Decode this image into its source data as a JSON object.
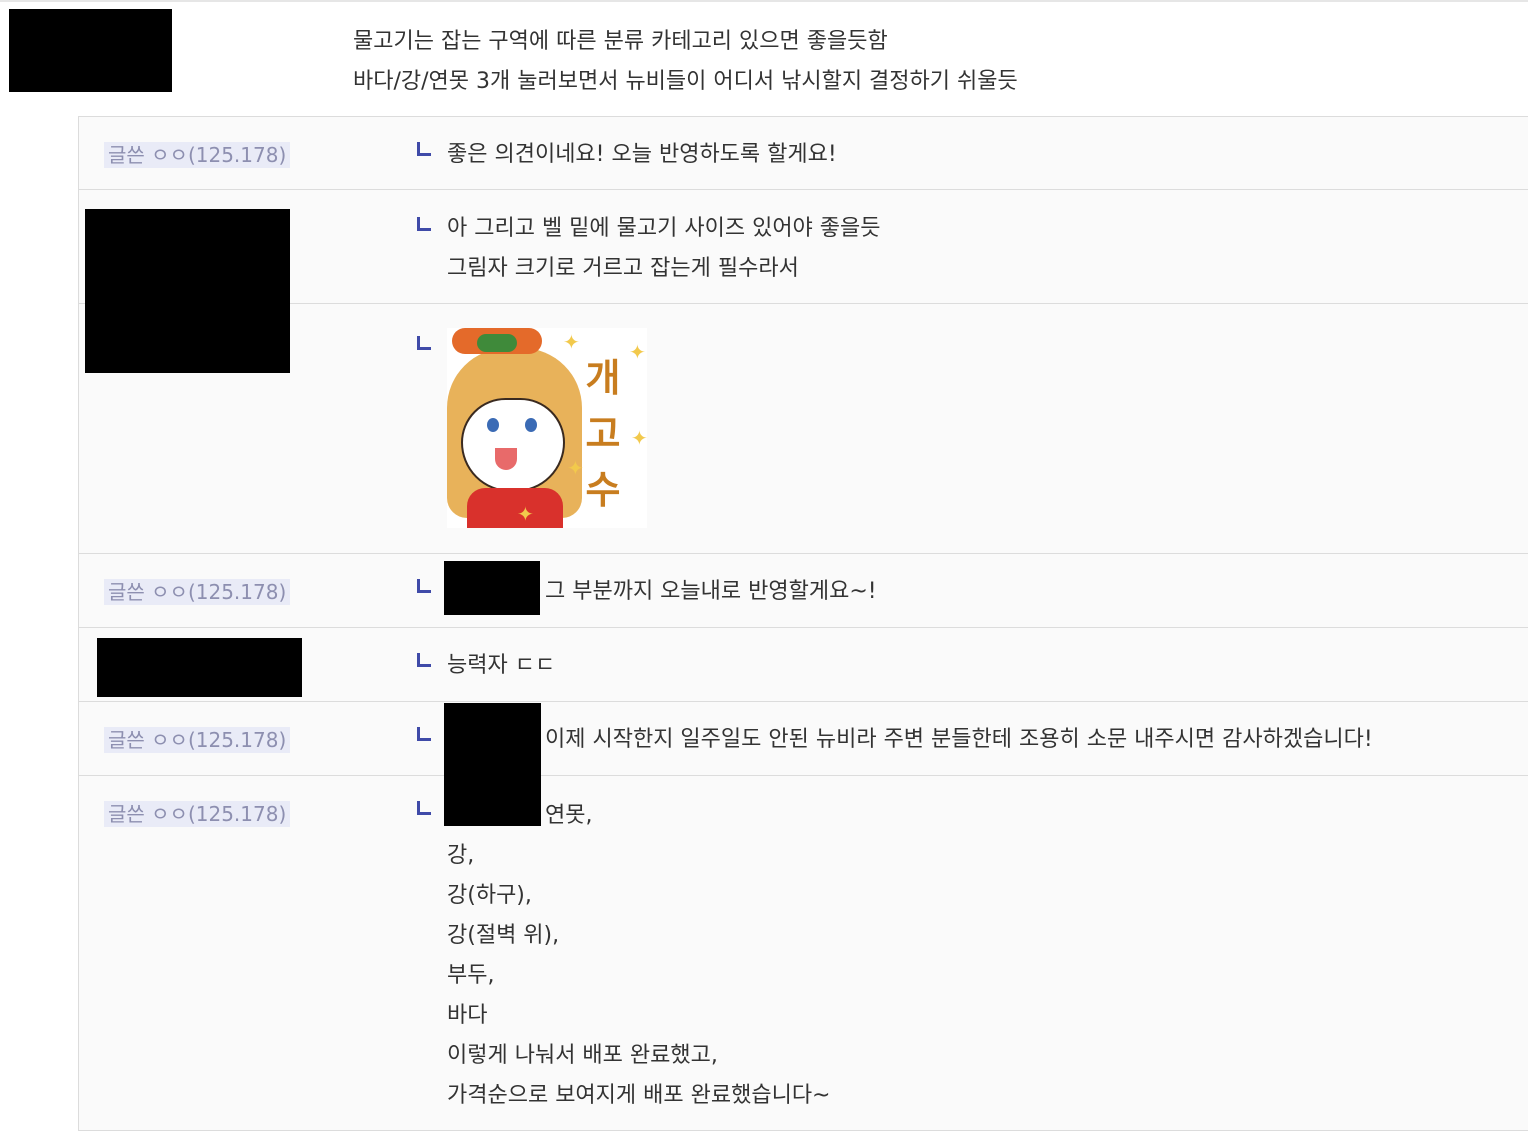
{
  "comment": {
    "lines": [
      "물고기는 잡는 구역에 따른 분류 카테고리 있으면 좋을듯함",
      "바다/강/연못 3개 눌러보면서 뉴비들이 어디서 낚시할지 결정하기 쉬울듯"
    ]
  },
  "replies": [
    {
      "author_badge": "글쓴 ㅇㅇ(125.178)",
      "lines": [
        "좋은 의견이네요! 오늘 반영하도록 할게요!"
      ]
    },
    {
      "lines": [
        "아 그리고 벨 밑에 물고기 사이즈 있어야 좋을듯",
        "그림자 크기로 거르고 잡는게 필수라서"
      ]
    },
    {
      "sticker": {
        "text": "개고수"
      }
    },
    {
      "author_badge": "글쓴 ㅇㅇ(125.178)",
      "lines": [
        "그 부분까지 오늘내로 반영할게요~!"
      ]
    },
    {
      "lines": [
        "능력자 ㄷㄷ"
      ]
    },
    {
      "author_badge": "글쓴 ㅇㅇ(125.178)",
      "lines": [
        "이제 시작한지 일주일도 안된 뉴비라 주변 분들한테 조용히 소문 내주시면 감사하겠습니다!"
      ]
    },
    {
      "author_badge": "글쓴 ㅇㅇ(125.178)",
      "lines": [
        "연못,",
        "강,",
        "강(하구),",
        "강(절벽 위),",
        "부두,",
        "바다",
        "이렇게 나눠서 배포 완료했고,",
        "가격순으로 보여지게 배포 완료했습니다~"
      ]
    }
  ]
}
